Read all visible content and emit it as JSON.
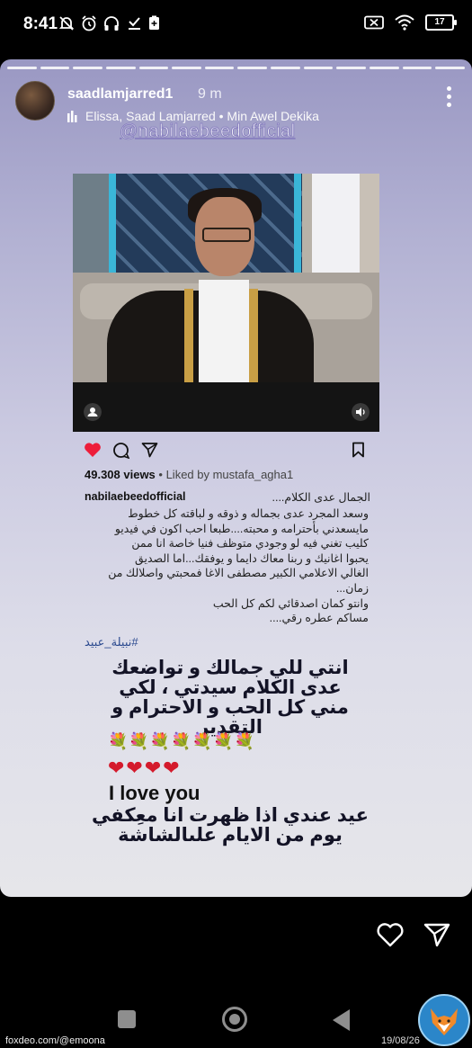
{
  "status_bar": {
    "time": "8:41",
    "battery": "17"
  },
  "story": {
    "username": "saadlamjarred1",
    "time_ago": "9 m",
    "music": "Elissa, Saad Lamjarred • Min Awel Dekika",
    "mention": "@nabilaebeedofficial",
    "segments": 14
  },
  "post": {
    "views": "49.308 views",
    "liked_by": " • Liked by mustafa_agha1",
    "caption_user": "nabilaebeedofficial",
    "caption_first": "الجمال عدى الكلام....",
    "caption_lines": [
      "وسعد المجرد عدى بجماله و ذوقه و لباقته كل خطوط",
      "مايسعدني بأحترامه و محبته....طبعا احب اكون في فيديو",
      "كليب تغني فيه لو وجودي متوظف فنيا خاصة انا ممن",
      "يحبوا اغانيك و ربنا معاك دايما و يوفقك...اما الصديق",
      "الغالي الاعلامي الكبير مصطفى الاغا فمحبتي واصلالك من",
      "زمان...",
      "وانتو كمان اصدقائي لكم كل الحب",
      "مساكم عطره رقي...."
    ],
    "hashtag": "#نبيلة_عبيد"
  },
  "overlay": {
    "lines": [
      "انتي للي جمالك و تواضعك",
      "عدى الكلام سيدتي ، لكي",
      "مني كل الحب و الاحترام و",
      "التقدير"
    ],
    "flowers": "💐💐💐💐💐💐💐",
    "hearts": "❤❤❤❤",
    "english": "I love you",
    "ending_lines": [
      "عيد عندي اذا ظهرت انا معِك",
      "في يوم من الايام على",
      "الشاشة"
    ]
  },
  "footer": {
    "watermark": "foxdeo.com/@emoona",
    "date": "19/08/26"
  },
  "colors": {
    "story_top": "#9a98c3",
    "story_bottom": "#e6e6ea",
    "like_red": "#ed1d3a",
    "hashtag_blue": "#2b4a8f"
  }
}
